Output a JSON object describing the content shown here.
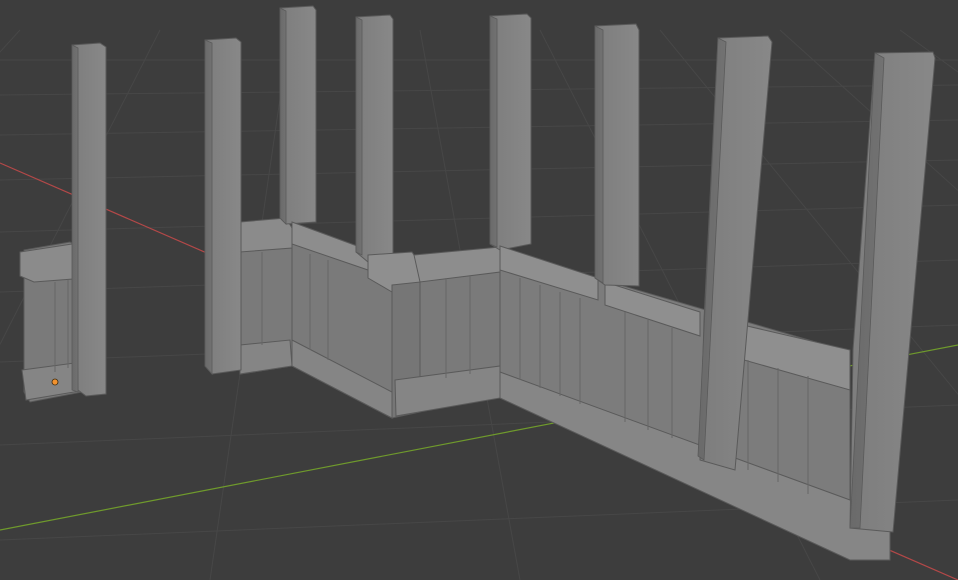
{
  "viewport": {
    "background": "#3d3d3d",
    "grid_color": "#4a4a4a",
    "x_axis_color": "#b34848",
    "y_axis_color": "#6f9a2c",
    "object_origin_color": "#f2922e"
  },
  "scene": {
    "object_type": "wooden fence / wall segments with posts",
    "mesh_color": "#8a8a8a"
  }
}
